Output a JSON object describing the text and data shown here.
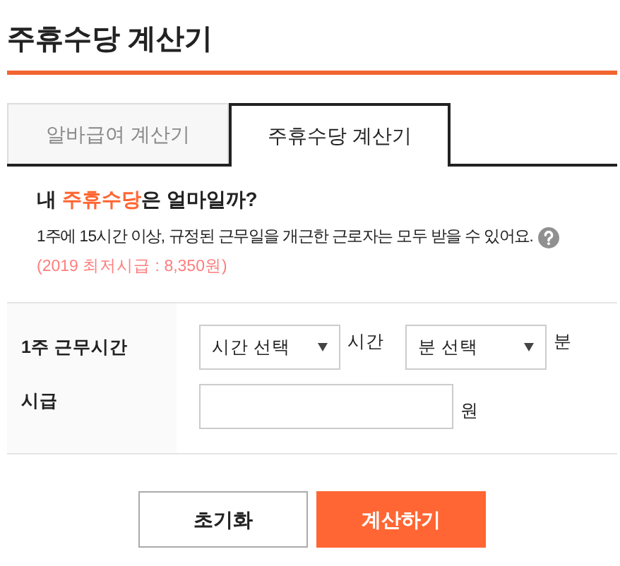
{
  "title": "주휴수당 계산기",
  "tabs": [
    {
      "label": "알바급여 계산기",
      "selected": false
    },
    {
      "label": "주휴수당 계산기",
      "selected": true
    }
  ],
  "intro": {
    "heading": "내 **주휴수당**은 얼마일까?",
    "description": "1주에 15시간 이상, 규정된 근무일을 개근한 근로자는 모두 받을 수 있어요.",
    "note": "(2019 최저시급 : 8,350원)"
  },
  "form": {
    "rows": [
      {
        "label": "1주 근무시간",
        "fields": [
          {
            "kind": "select",
            "value": "시간 선택",
            "unit": "시간"
          },
          {
            "kind": "select",
            "value": "분 선택",
            "unit": "분"
          }
        ]
      },
      {
        "label": "시급",
        "fields": [
          {
            "kind": "input",
            "unit": "원"
          }
        ]
      }
    ]
  },
  "buttons": [
    {
      "label": "초기화",
      "kind": "secondary"
    },
    {
      "label": "계산하기",
      "kind": "primary"
    }
  ]
}
